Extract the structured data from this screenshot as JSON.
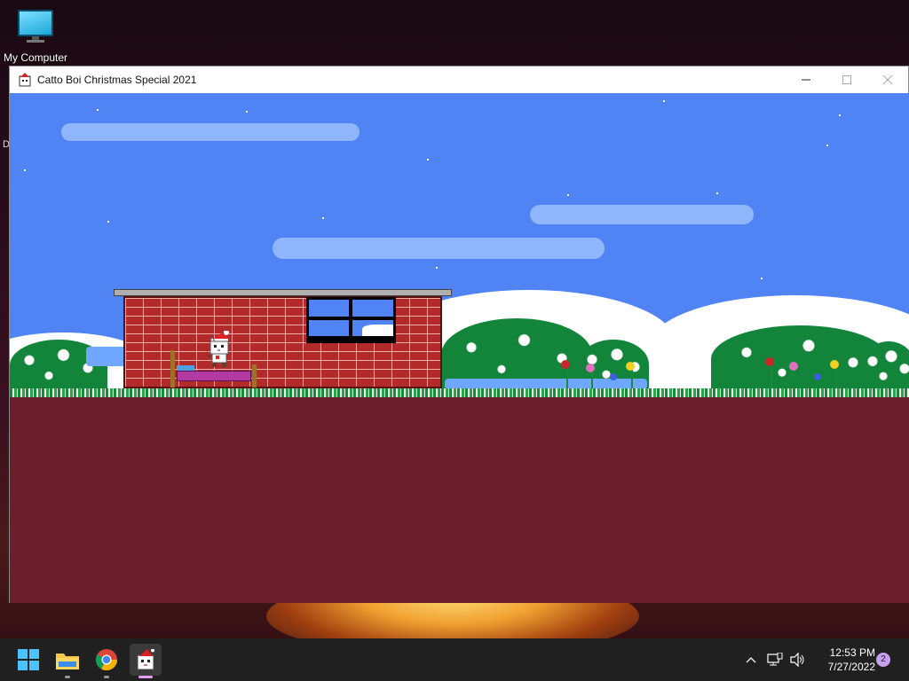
{
  "desktop": {
    "icons": [
      {
        "label": "My Computer",
        "icon": "computer-icon"
      }
    ],
    "side_letter": "D"
  },
  "window": {
    "title": "Catto Boi Christmas Special 2021",
    "controls": [
      "minimize",
      "maximize",
      "close"
    ]
  },
  "taskbar": {
    "apps": [
      {
        "name": "Start",
        "icon": "windows-start-icon",
        "active": false
      },
      {
        "name": "File Explorer",
        "icon": "folder-icon",
        "active": false,
        "running": true
      },
      {
        "name": "Google Chrome",
        "icon": "chrome-icon",
        "active": false,
        "running": true
      },
      {
        "name": "Catto Boi Christmas Special 2021",
        "icon": "catto-boi-icon",
        "active": true,
        "running": true
      }
    ],
    "tray": {
      "icons": [
        "chevron-up-icon",
        "network-icon",
        "volume-icon"
      ],
      "time": "12:53 PM",
      "date": "7/27/2022",
      "notification_count": "2"
    }
  },
  "colors": {
    "sky": "#5084f4",
    "cloud": "#8fb6fb",
    "ground": "#6b1f2c",
    "brick": "#b22a2a",
    "bush": "#12853a",
    "taskbar": "#202020"
  }
}
